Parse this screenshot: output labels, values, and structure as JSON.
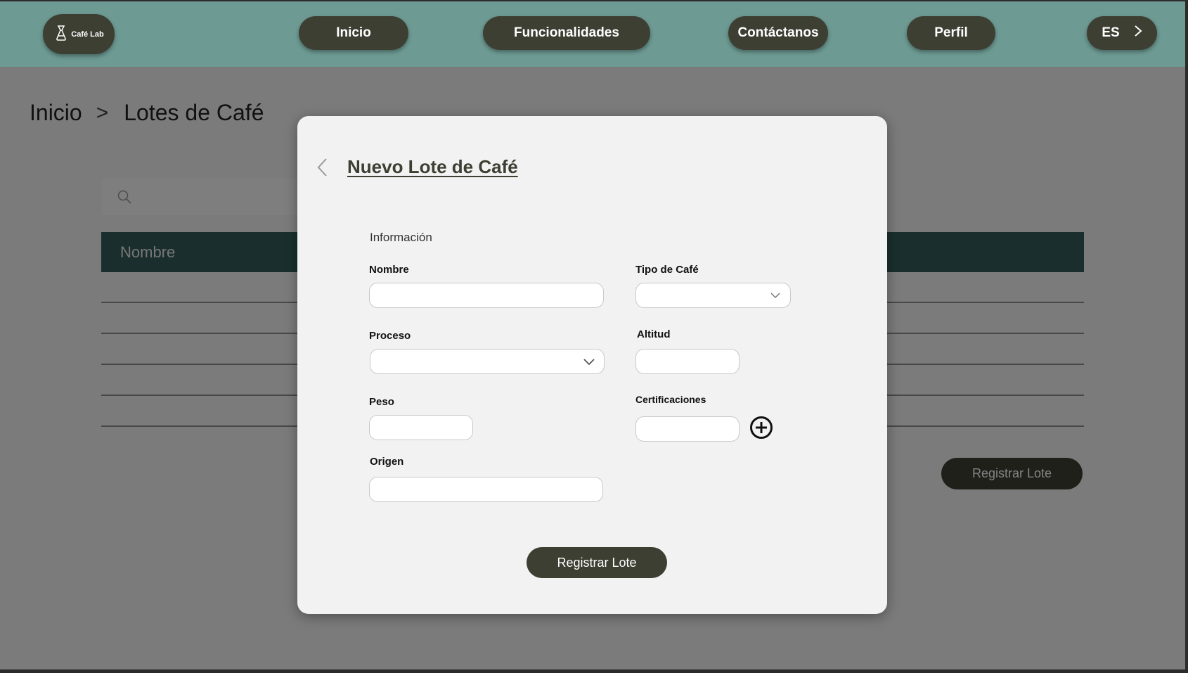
{
  "header": {
    "logo_text": "Café Lab",
    "nav": {
      "inicio": "Inicio",
      "funcionalidades": "Funcionalidades",
      "contactanos": "Contáctanos",
      "perfil": "Perfil",
      "language": "ES"
    }
  },
  "breadcrumb": {
    "home": "Inicio",
    "separator": ">",
    "current": "Lotes de Café"
  },
  "search": {
    "placeholder": ""
  },
  "table": {
    "columns": [
      "Nombre"
    ],
    "rows": [
      "",
      "",
      "",
      "",
      ""
    ]
  },
  "page": {
    "register_button": "Registrar Lote"
  },
  "modal": {
    "title": "Nuevo Lote de Café",
    "section": "Información",
    "fields": {
      "nombre": {
        "label": "Nombre",
        "value": ""
      },
      "tipo_cafe": {
        "label": "Tipo de Café",
        "value": ""
      },
      "proceso": {
        "label": "Proceso",
        "value": ""
      },
      "altitud": {
        "label": "Altitud",
        "value": ""
      },
      "peso": {
        "label": "Peso",
        "value": ""
      },
      "certificaciones": {
        "label": "Certificaciones",
        "value": ""
      },
      "origen": {
        "label": "Origen",
        "value": ""
      }
    },
    "submit": "Registrar Lote"
  },
  "colors": {
    "header_bg": "#6d9a93",
    "pill_bg": "#3d3f33",
    "table_header_bg": "#345d58",
    "modal_bg": "#f2f2f2"
  },
  "icons": [
    "coffee-maker-icon",
    "chevron-right-icon",
    "search-icon",
    "chevron-left-icon",
    "chevron-down-icon",
    "plus-circle-icon"
  ]
}
